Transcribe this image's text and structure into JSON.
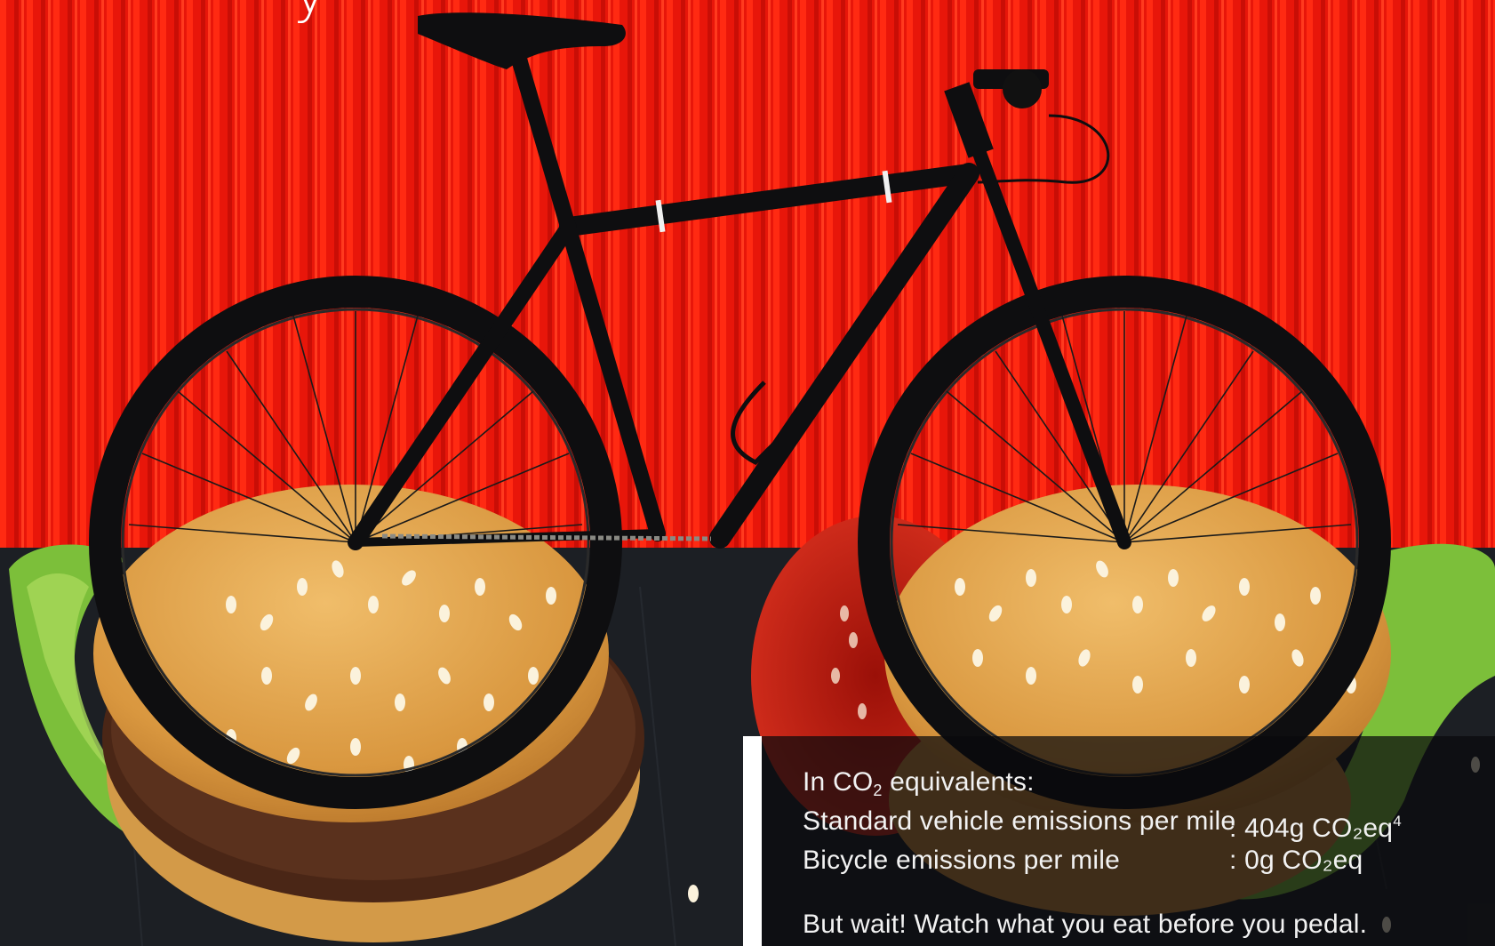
{
  "photo": {
    "subject_top": "bicycle-icon",
    "subject_bottom": "burger-icon",
    "colors": {
      "wall_red": "#e8160a",
      "slate_dark": "#1c1f24",
      "bike_black": "#0e0e10",
      "bun": "#dca050",
      "lettuce": "#7cbf3a",
      "tomato": "#c8261a",
      "patty": "#4a2616"
    }
  },
  "headline_fragment": "y",
  "info": {
    "intro_prefix": "In CO",
    "intro_sub": "2",
    "intro_suffix": " equivalents:",
    "rows": [
      {
        "label": "Standard vehicle emissions per mile",
        "colon": ":",
        "value": "404g CO₂eq",
        "footnote": "4"
      },
      {
        "label": "Bicycle emissions per mile",
        "colon": ":",
        "value": "0g CO₂eq"
      }
    ],
    "teaser": "But wait! Watch what you eat before you pedal."
  }
}
